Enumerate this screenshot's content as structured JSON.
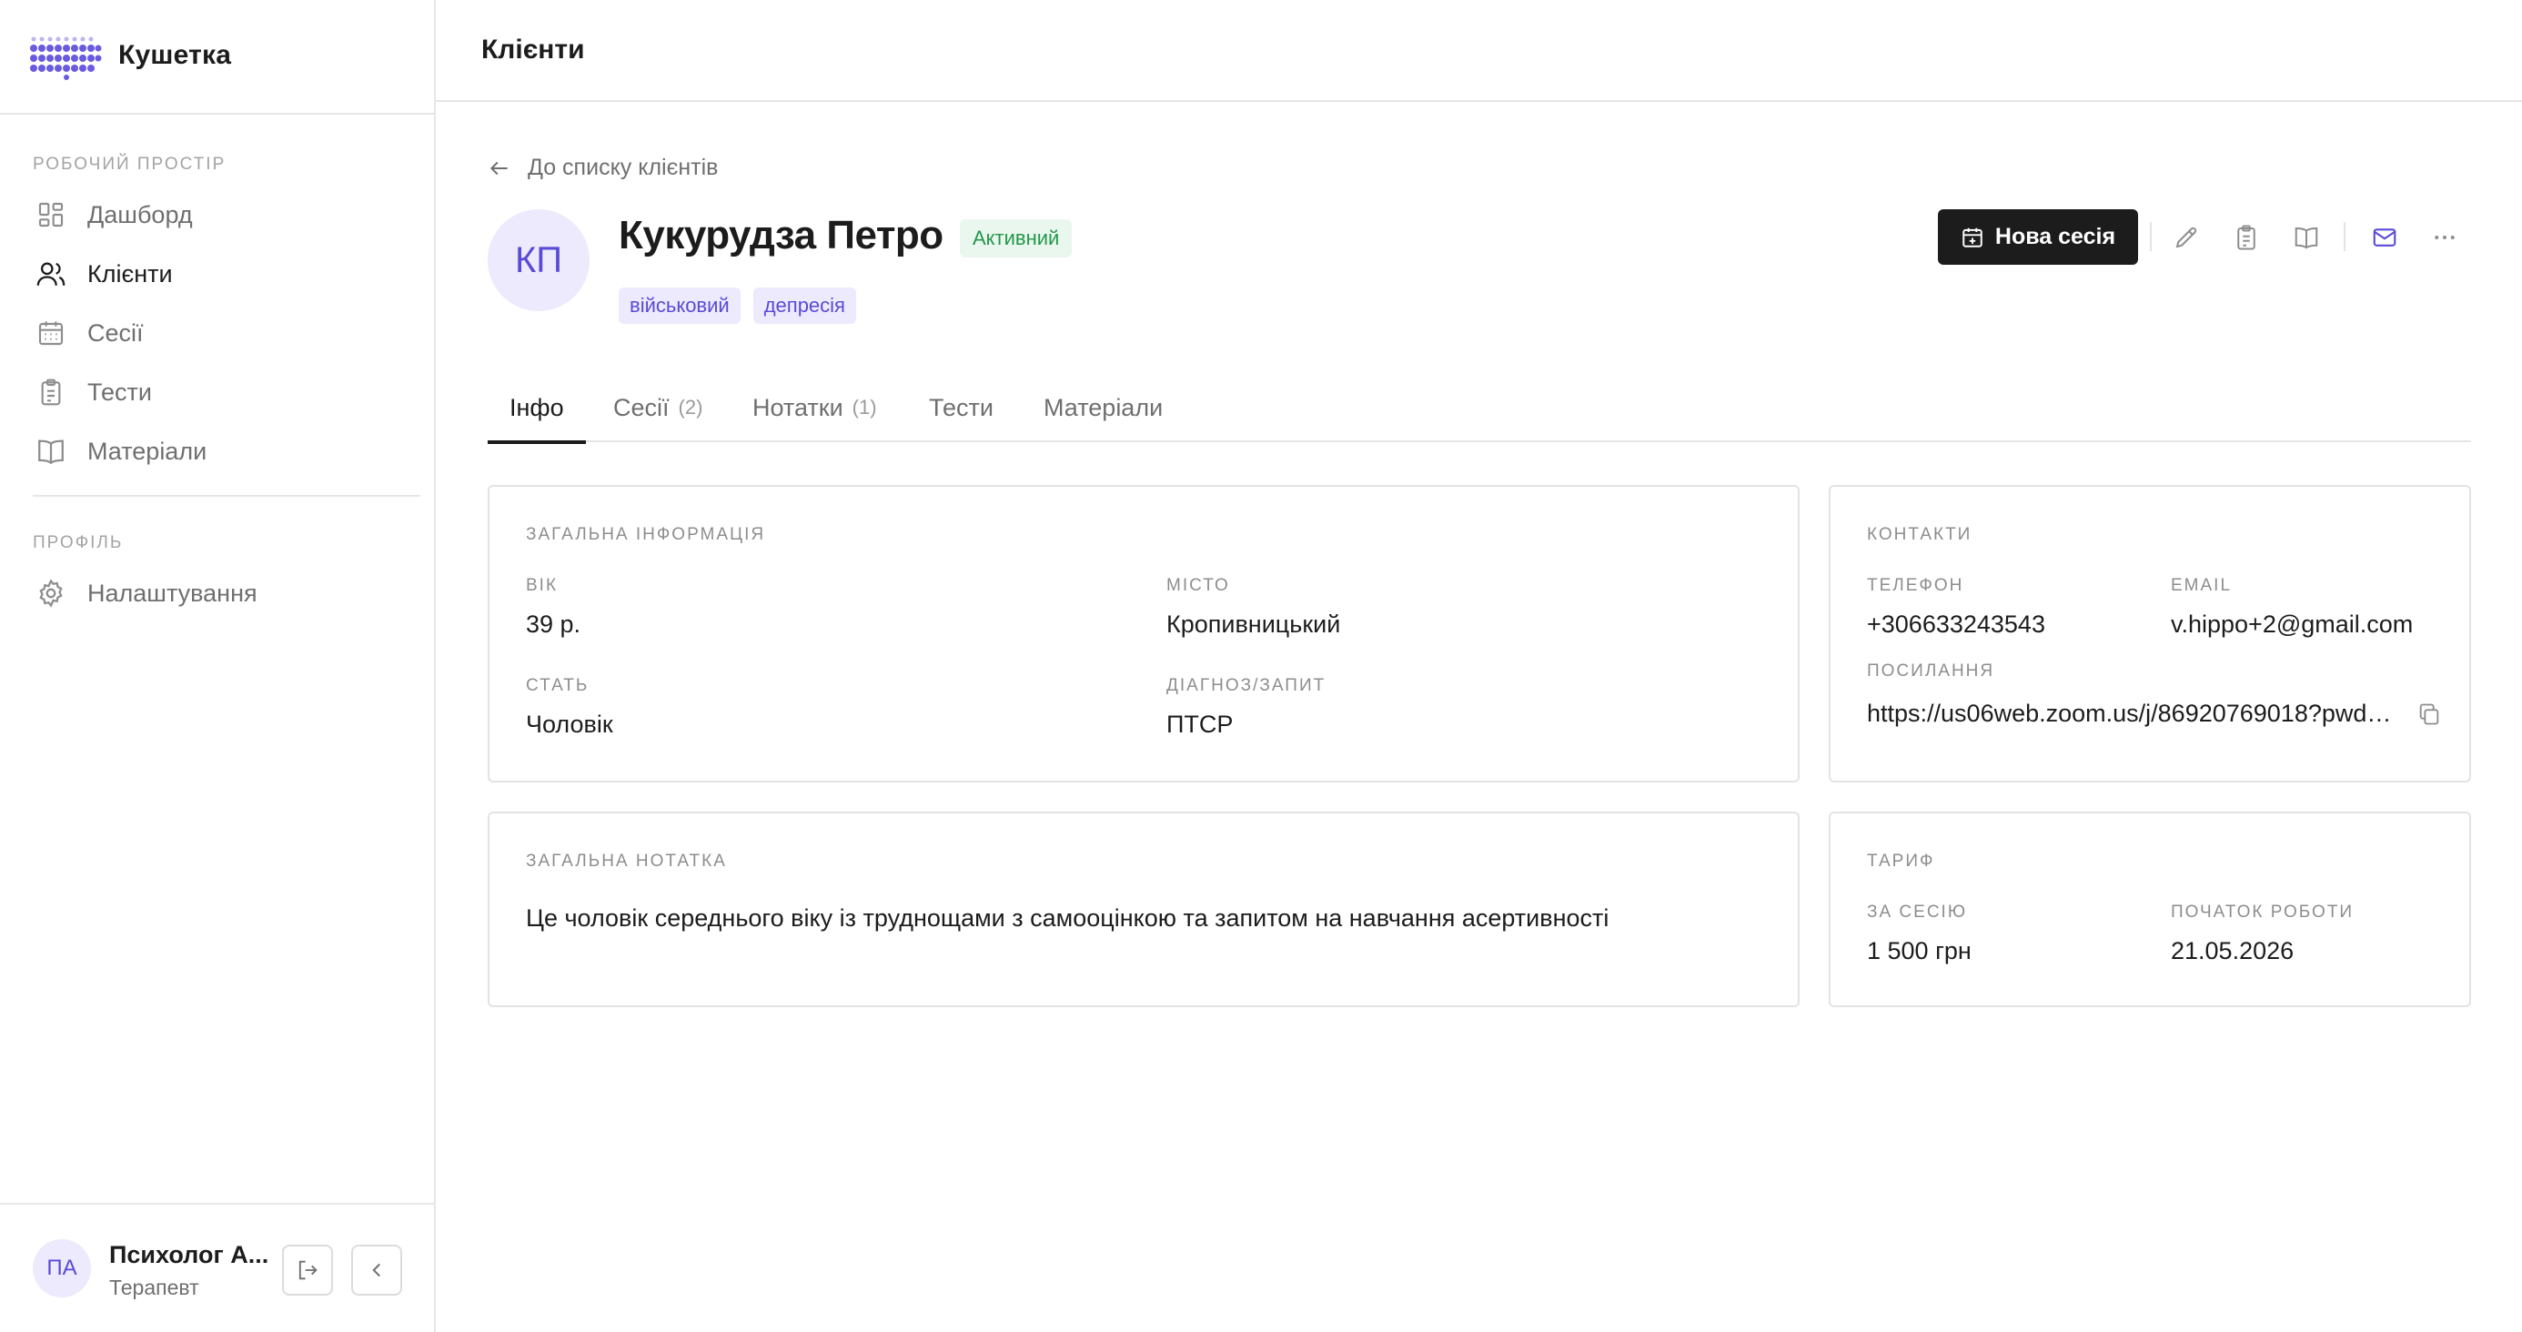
{
  "app": {
    "name": "Кушетка"
  },
  "sidebar": {
    "workspace_title": "Робочий простір",
    "items": [
      {
        "label": "Дашборд",
        "icon": "dashboard-icon"
      },
      {
        "label": "Клієнти",
        "icon": "users-icon",
        "active": true
      },
      {
        "label": "Сесії",
        "icon": "calendar-icon"
      },
      {
        "label": "Тести",
        "icon": "clipboard-icon"
      },
      {
        "label": "Матеріали",
        "icon": "book-icon"
      }
    ],
    "profile_title": "Профіль",
    "profile_items": [
      {
        "label": "Налаштування",
        "icon": "gear-icon"
      }
    ],
    "user": {
      "initials": "ПА",
      "name": "Психолог А...",
      "role": "Терапевт"
    }
  },
  "header": {
    "title": "Клієнти"
  },
  "client": {
    "back_label": "До списку клієнтів",
    "initials": "КП",
    "name": "Кукурудза Петро",
    "status": "Активний",
    "tags": [
      "військовий",
      "депресія"
    ],
    "new_session_label": "Нова сесія"
  },
  "tabs": [
    {
      "label": "Інфо",
      "count": "",
      "active": true
    },
    {
      "label": "Сесії",
      "count": "(2)"
    },
    {
      "label": "Нотатки",
      "count": "(1)"
    },
    {
      "label": "Тести",
      "count": ""
    },
    {
      "label": "Матеріали",
      "count": ""
    }
  ],
  "general_info": {
    "title": "Загальна інформація",
    "age_label": "Вік",
    "age": "39 р.",
    "city_label": "Місто",
    "city": "Кропивницький",
    "gender_label": "Стать",
    "gender": "Чоловік",
    "diagnosis_label": "Діагноз/запит",
    "diagnosis": "ПТСР"
  },
  "contacts": {
    "title": "Контакти",
    "phone_label": "Телефон",
    "phone": "+306633243543",
    "email_label": "Email",
    "email": "v.hippo+2@gmail.com",
    "link_label": "Посилання",
    "link": "https://us06web.zoom.us/j/86920769018?pwd=..."
  },
  "note": {
    "title": "Загальна нотатка",
    "text": "Це чоловік середнього віку із труднощами з самооцінкою та запитом на навчання асертивності"
  },
  "tariff": {
    "title": "Тариф",
    "per_session_label": "За сесію",
    "per_session": "1 500 грн",
    "start_label": "Початок роботи",
    "start": "21.05.2026"
  },
  "colors": {
    "accent": "#5a4bd6",
    "status_green": "#23974b",
    "primary_button": "#1c1c1c"
  }
}
